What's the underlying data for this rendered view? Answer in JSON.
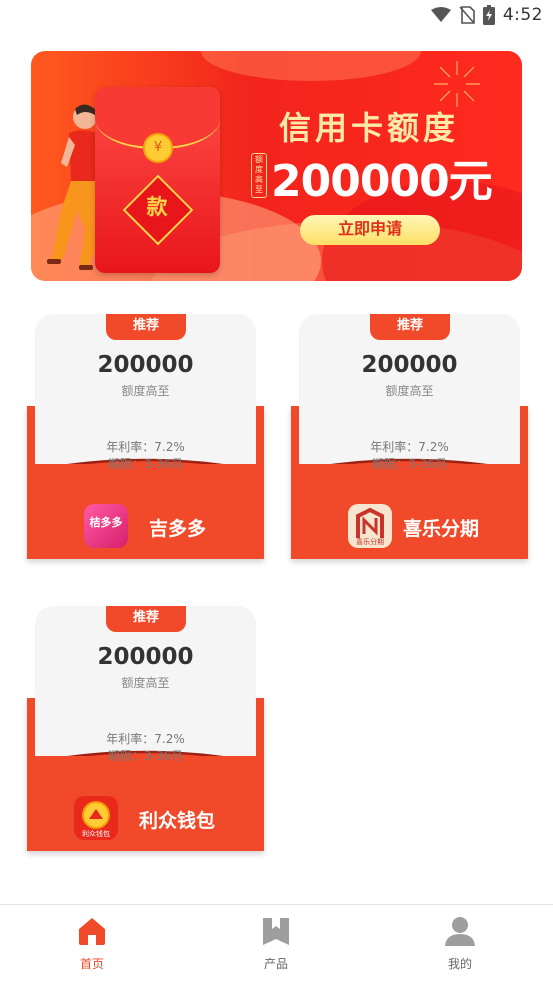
{
  "status_bar": {
    "time": "4:52",
    "icons": [
      "wifi-icon",
      "no-sim-icon",
      "battery-charging-icon"
    ]
  },
  "banner": {
    "title": "信用卡额度",
    "tag": "额度高至",
    "amount": "200000元",
    "button_label": "立即申请",
    "envelope_char": "款",
    "coin_char": "¥"
  },
  "products": [
    {
      "badge": "推荐",
      "amount": "200000",
      "amount_label": "额度高至",
      "rate": "年利率：7.2%",
      "term": "期限：3-36月",
      "name": "吉多多",
      "logo_text": "桔多多",
      "logo_color": "#e9337a"
    },
    {
      "badge": "推荐",
      "amount": "200000",
      "amount_label": "额度高至",
      "rate": "年利率：7.2%",
      "term": "期限：3-36月",
      "name": "喜乐分期",
      "logo_text": "喜乐分期",
      "logo_color": "#c9332a"
    },
    {
      "badge": "推荐",
      "amount": "200000",
      "amount_label": "额度高至",
      "rate": "年利率：7.2%",
      "term": "期限：3-36月",
      "name": "利众钱包",
      "logo_text": "利众钱包",
      "logo_color": "#e8291c"
    }
  ],
  "bottom_nav": {
    "tabs": [
      {
        "label": "首页",
        "icon": "home-icon",
        "active": true
      },
      {
        "label": "产品",
        "icon": "bookmark-icon",
        "active": false
      },
      {
        "label": "我的",
        "icon": "user-icon",
        "active": false
      }
    ]
  },
  "colors": {
    "accent": "#f04a2a",
    "banner_gold": "#ffe9a8",
    "inactive_icon": "#9e9e9e"
  }
}
